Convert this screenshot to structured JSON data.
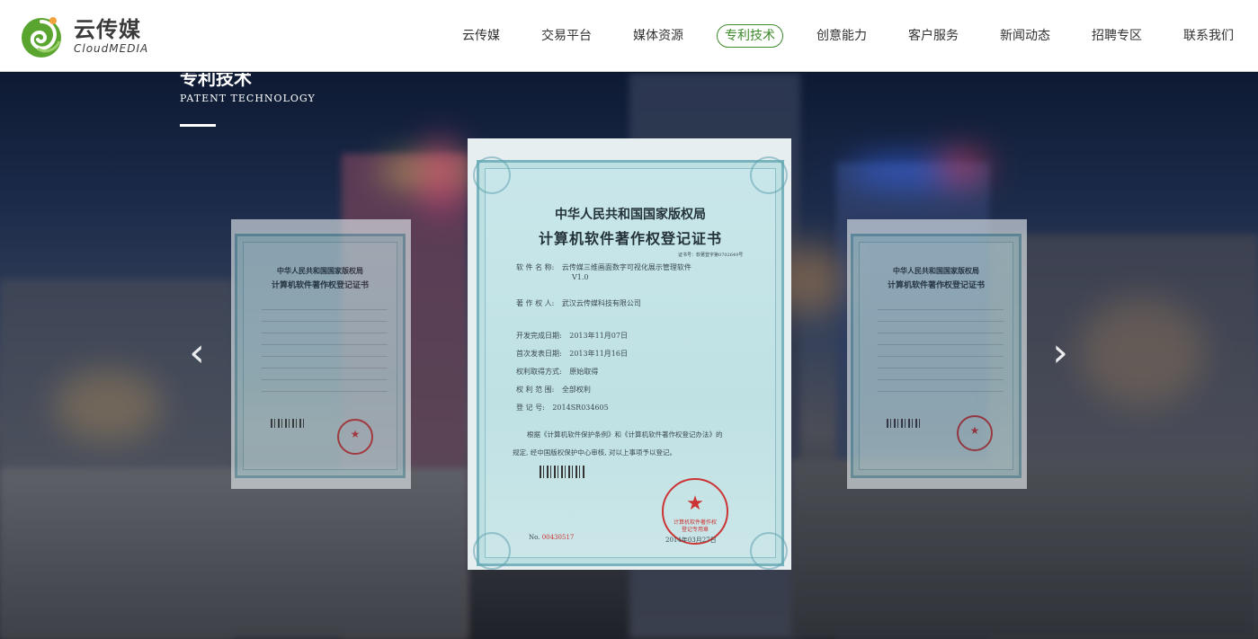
{
  "logo": {
    "name_cn": "云传媒",
    "name_en": "CloudMEDIA"
  },
  "nav": {
    "items": [
      "云传媒",
      "交易平台",
      "媒体资源",
      "专利技术",
      "创意能力",
      "客户服务",
      "新闻动态",
      "招聘专区",
      "联系我们"
    ],
    "active_index": 3
  },
  "section": {
    "title_cn": "专利技术",
    "title_en": "PATENT TECHNOLOGY"
  },
  "certificate": {
    "authority": "中华人民共和国国家版权局",
    "title": "计算机软件著作权登记证书",
    "cert_no_label": "证书号：",
    "cert_no": "软著登字第0702649号",
    "rows": [
      {
        "label": "软 件 名 称:",
        "value": "云传媒三维画面数字可视化展示管理软件"
      },
      {
        "label": "",
        "value": "V1.0"
      },
      {
        "label": "著 作 权 人:",
        "value": "武汉云传媒科技有限公司"
      },
      {
        "label": "开发完成日期:",
        "value": "2013年11月07日"
      },
      {
        "label": "首次发表日期:",
        "value": "2013年11月16日"
      },
      {
        "label": "权利取得方式:",
        "value": "原始取得"
      },
      {
        "label": "权 利 范 围:",
        "value": "全部权利"
      },
      {
        "label": "登   记   号:",
        "value": "2014SR034605"
      }
    ],
    "basis_line1": "根据《计算机软件保护条例》和《计算机软件著作权登记办法》的",
    "basis_line2": "规定, 经中国版权保护中心审核, 对以上事项予以登记。",
    "serial_label": "No.",
    "serial": "00430517",
    "date": "2014年03月27日",
    "stamp_line1": "计算机软件著作权",
    "stamp_line2": "登记专用章"
  },
  "side_left": {
    "authority": "中华人民共和国国家版权局",
    "title": "计算机软件著作权登记证书"
  },
  "side_right": {
    "authority": "中华人民共和国国家版权局",
    "title": "计算机软件著作权登记证书"
  },
  "arrows": {
    "prev": "‹",
    "next": "›"
  },
  "colors": {
    "accent": "#3c8a2a",
    "cert_border": "#79b3bd",
    "stamp": "#cc3333"
  }
}
